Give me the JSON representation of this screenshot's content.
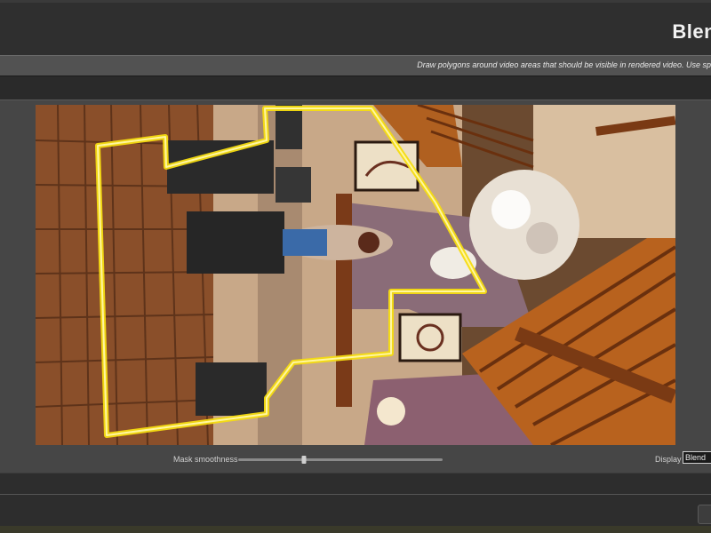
{
  "app": {
    "title": "Blend"
  },
  "info_bar": {
    "text": "Draw polygons around video areas that should be visible in rendered video. Use sp"
  },
  "controls": {
    "mask_smoothness_label": "Mask smoothness",
    "mask_smoothness_value": 0.32,
    "display_label": "Display",
    "display_value": "Blend"
  },
  "colors": {
    "mask_outline": "#f5dc10",
    "panel": "#464646",
    "toolbar": "#2f2f2f"
  }
}
